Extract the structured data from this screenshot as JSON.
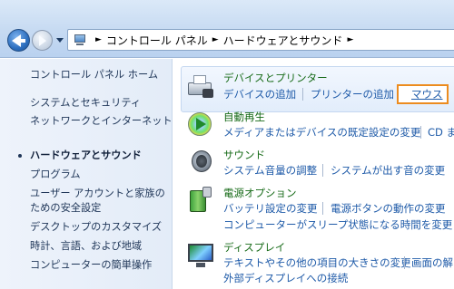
{
  "address_bar": {
    "breadcrumbs": [
      "コントロール パネル",
      "ハードウェアとサウンド"
    ]
  },
  "sidebar": {
    "home": "コントロール パネル ホーム",
    "items": [
      {
        "label": "システムとセキュリティ"
      },
      {
        "label": "ネットワークとインターネット"
      },
      {
        "label": "ハードウェアとサウンド",
        "current": true
      },
      {
        "label": "プログラム"
      },
      {
        "label": "ユーザー アカウントと家族の"
      },
      {
        "label": "ための安全設定"
      },
      {
        "label": "デスクトップのカスタマイズ"
      },
      {
        "label": "時計、言語、および地域"
      },
      {
        "label": "コンピューターの簡単操作"
      }
    ]
  },
  "categories": [
    {
      "title": "デバイスとプリンター",
      "icon": "printer-icon",
      "links": [
        "デバイスの追加",
        "プリンターの追加",
        "マウス"
      ]
    },
    {
      "title": "自動再生",
      "icon": "autoplay-icon",
      "links": [
        "メディアまたはデバイスの既定設定の変更",
        "CD ま"
      ]
    },
    {
      "title": "サウンド",
      "icon": "speaker-icon",
      "links": [
        "システム音量の調整",
        "システムが出す音の変更"
      ]
    },
    {
      "title": "電源オプション",
      "icon": "power-icon",
      "links": [
        "バッテリ設定の変更",
        "電源ボタンの動作の変更",
        "コンピューターがスリープ状態になる時間を変更"
      ]
    },
    {
      "title": "ディスプレイ",
      "icon": "display-icon",
      "links": [
        "テキストやその他の項目の大きさの変更",
        "画面の解",
        "外部ディスプレイへの接続"
      ]
    }
  ],
  "colors": {
    "category_title": "#166a17",
    "link": "#1e5aa8",
    "highlight_border": "#ec8c1f"
  }
}
